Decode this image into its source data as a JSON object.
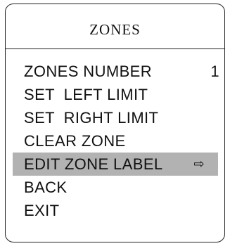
{
  "title": "ZONES",
  "menu": {
    "items": [
      {
        "label": "ZONES NUMBER",
        "value": "1"
      },
      {
        "label": "SET  LEFT LIMIT"
      },
      {
        "label": "SET  RIGHT LIMIT"
      },
      {
        "label": "CLEAR ZONE"
      },
      {
        "label": "EDIT ZONE LABEL",
        "selected": true,
        "arrow": "⇨",
        "icon": "arrow-right-icon"
      },
      {
        "label": "BACK"
      },
      {
        "label": "EXIT"
      }
    ]
  },
  "colors": {
    "selected_background": "#b2b2b2",
    "border": "#222222"
  }
}
